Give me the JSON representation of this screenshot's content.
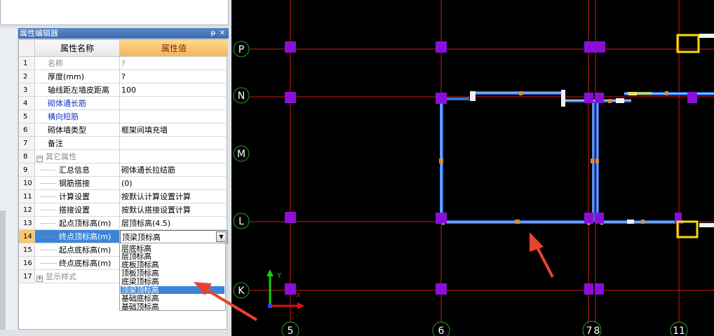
{
  "property_editor": {
    "title": "属性编辑器",
    "pin_icon": "pin-icon",
    "close_icon": "close-icon",
    "header": {
      "name_col": "属性名称",
      "value_col": "属性值"
    },
    "rows": [
      {
        "num": "1",
        "name": "名称",
        "value": "?"
      },
      {
        "num": "2",
        "name": "厚度(mm)",
        "value": "?"
      },
      {
        "num": "3",
        "name": "轴线距左墙皮距离",
        "value": "100"
      },
      {
        "num": "4",
        "name": "砌体通长筋",
        "value": ""
      },
      {
        "num": "5",
        "name": "横向短筋",
        "value": ""
      },
      {
        "num": "6",
        "name": "砌体墙类型",
        "value": "框架间填充墙"
      },
      {
        "num": "7",
        "name": "备注",
        "value": ""
      },
      {
        "num": "8",
        "name": "其它属性",
        "value": ""
      },
      {
        "num": "9",
        "name": "汇总信息",
        "value": "砌体通长拉结筋"
      },
      {
        "num": "10",
        "name": "钢筋搭接",
        "value": "(0)"
      },
      {
        "num": "11",
        "name": "计算设置",
        "value": "按默认计算设置计算"
      },
      {
        "num": "12",
        "name": "搭接设置",
        "value": "按默认搭接设置计算"
      },
      {
        "num": "13",
        "name": "起点顶标高(m)",
        "value": "层顶标高(4.5)"
      },
      {
        "num": "14",
        "name": "终点顶标高(m)",
        "value": "顶梁顶标高"
      },
      {
        "num": "15",
        "name": "起点底标高(m)",
        "value": ""
      },
      {
        "num": "16",
        "name": "终点底标高(m)",
        "value": ""
      },
      {
        "num": "17",
        "name": "显示样式",
        "value": ""
      }
    ],
    "dropdown_options": [
      "层底标高",
      "层顶标高",
      "底板顶标高",
      "顶板顶标高",
      "底梁顶标高",
      "顶梁顶标高",
      "基础底标高",
      "基础顶标高"
    ],
    "dropdown_selected": "顶梁顶标高"
  },
  "canvas": {
    "row_axes": [
      "P",
      "N",
      "M",
      "L",
      "K"
    ],
    "column_axes": [
      "5",
      "6",
      "7",
      "8",
      "11"
    ],
    "ucs_x_label": "X",
    "ucs_y_label": "Y",
    "colors": {
      "background": "#000000",
      "grid_line": "#d01a1a",
      "column": "#8a10d8",
      "wall": "#2f6fd8",
      "axis_bubble": "#2aa02a",
      "highlight_frame": "#f0e000",
      "annotation_arrow": "#e8432e"
    }
  }
}
